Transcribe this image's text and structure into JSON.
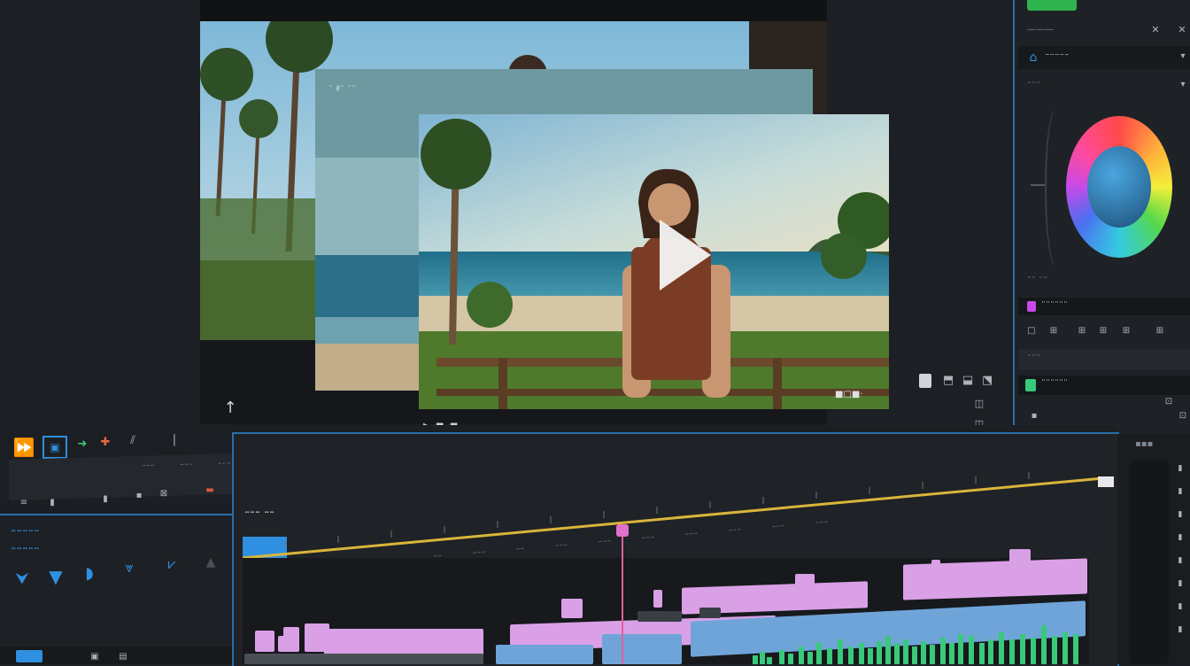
{
  "preview": {
    "mid_label": "¨ ª¨ ¨¨",
    "bottom_right": "■□■·",
    "play_icon": "play-icon",
    "toolbar_label": "▶ ·■ ·■"
  },
  "right_panel": {
    "top_button": "———",
    "title": "¨¨¨¨¨",
    "row1": "¨¨¨",
    "wheel_label": "color-wheel",
    "row2": "¨¨ ¨¨",
    "pink_label": "¨¨¨¨¨¨",
    "row3": "¨¨¨",
    "green_label": "¨¨¨¨¨¨"
  },
  "toolbar": {
    "items": [
      "¨¨¨",
      "¨¨¨",
      "¨¨¨¨",
      "¨¨¨",
      "¨¨",
      "¨¨",
      "¨ ¨¨¨",
      "¨¨¨¨¨¨¨"
    ]
  },
  "timeline": {
    "title": "¨¨¨ ¨¨",
    "ruler_marks": [
      "¨ ¨ ¨",
      "¨¨",
      "¨¨",
      "¨¨¨",
      "¨¨",
      "¨¨¨",
      "¨¨¨",
      "¨¨¨",
      "¨¨¨",
      "¨¨¨",
      "¨¨¨",
      "¨¨¨",
      "¨¨¨"
    ]
  },
  "left_panel": {
    "label1": "¨¨¨¨¨",
    "label2": "¨¨¨¨¨"
  },
  "colors": {
    "accent": "#2f8fe0",
    "playhead": "#e0609a",
    "pink": "#d9a0e6",
    "blue": "#6fa4d9",
    "green": "#38c97a",
    "yellow": "#d9b53a"
  }
}
